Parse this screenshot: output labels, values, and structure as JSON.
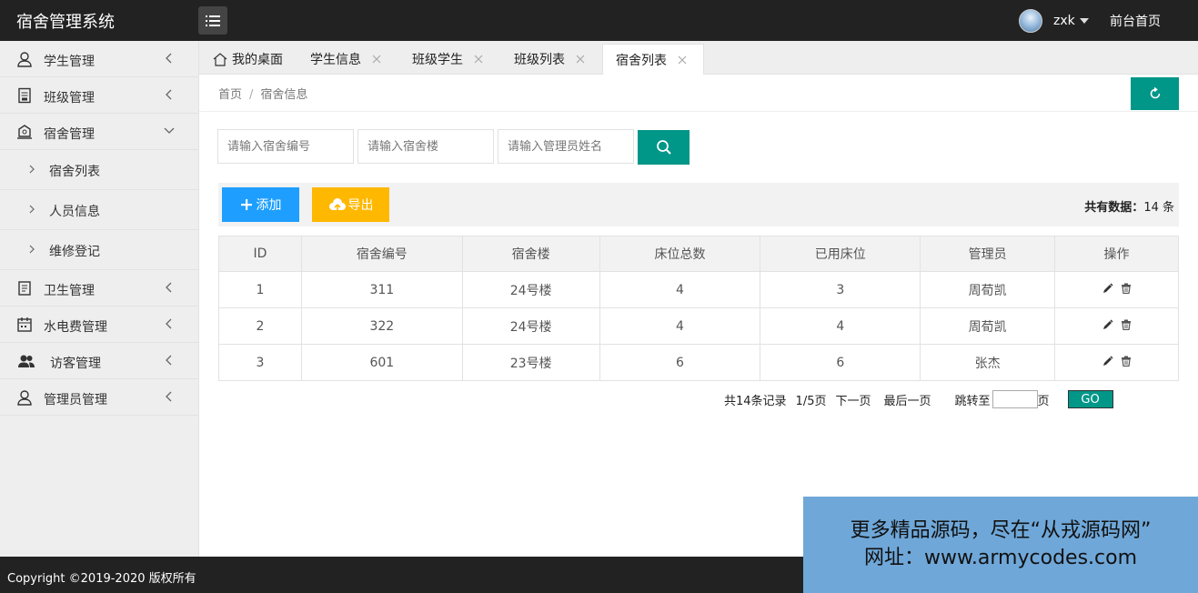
{
  "header": {
    "app_title": "宿舍管理系统",
    "username": "zxk",
    "front_link": "前台首页"
  },
  "sidebar": {
    "items": [
      {
        "label": "学生管理",
        "icon": "user-icon",
        "expanded": false
      },
      {
        "label": "班级管理",
        "icon": "class-icon",
        "expanded": false
      },
      {
        "label": "宿舍管理",
        "icon": "dorm-icon",
        "expanded": true
      },
      {
        "label": "卫生管理",
        "icon": "clipboard-icon",
        "expanded": false
      },
      {
        "label": "水电费管理",
        "icon": "calendar-icon",
        "expanded": false
      },
      {
        "label": "访客管理",
        "icon": "users-icon",
        "expanded": false
      },
      {
        "label": "管理员管理",
        "icon": "admin-icon",
        "expanded": false
      }
    ],
    "dorm_subitems": [
      "宿舍列表",
      "人员信息",
      "维修登记"
    ]
  },
  "tabs": [
    {
      "label": "我的桌面",
      "closable": false,
      "active": false
    },
    {
      "label": "学生信息",
      "closable": true,
      "active": false
    },
    {
      "label": "班级学生",
      "closable": true,
      "active": false
    },
    {
      "label": "班级列表",
      "closable": true,
      "active": false
    },
    {
      "label": "宿舍列表",
      "closable": true,
      "active": true
    }
  ],
  "breadcrumb": {
    "home": "首页",
    "separator": "/",
    "current": "宿舍信息"
  },
  "search": {
    "dorm_no_placeholder": "请输入宿舍编号",
    "building_placeholder": "请输入宿舍楼",
    "admin_placeholder": "请输入管理员姓名"
  },
  "toolbar": {
    "add_label": "添加",
    "export_label": "导出",
    "total_label": "共有数据：",
    "total_value": "14 条"
  },
  "table": {
    "headers": [
      "ID",
      "宿舍编号",
      "宿舍楼",
      "床位总数",
      "已用床位",
      "管理员",
      "操作"
    ],
    "rows": [
      [
        "1",
        "311",
        "24号楼",
        "4",
        "3",
        "周荀凯"
      ],
      [
        "2",
        "322",
        "24号楼",
        "4",
        "4",
        "周荀凯"
      ],
      [
        "3",
        "601",
        "23号楼",
        "6",
        "6",
        "张杰"
      ]
    ]
  },
  "pager": {
    "records": "共14条记录",
    "page_info": "1/5页",
    "next": "下一页",
    "last": "最后一页",
    "jump_to": "跳转至",
    "page_unit": "页",
    "go": "GO"
  },
  "footer": {
    "copyright": "Copyright ©2019-2020 版权所有"
  },
  "watermark": {
    "line1": "更多精品源码，尽在“从戎源码网”",
    "line2": "网址：www.armycodes.com"
  },
  "colors": {
    "header_bg": "#222222",
    "teal": "#009688",
    "blue": "#1e9fff",
    "orange": "#ffb800",
    "sidebar_bg": "#eeeeee",
    "watermark_bg": "#6fa7d8"
  }
}
